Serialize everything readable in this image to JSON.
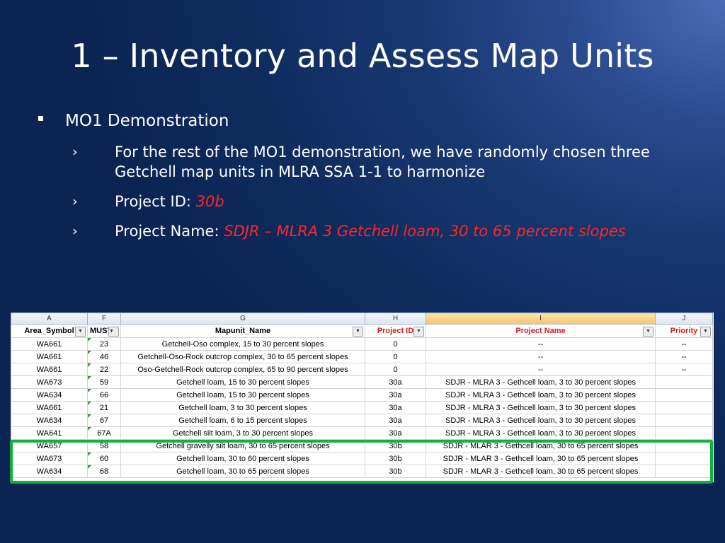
{
  "slide": {
    "title": "1 – Inventory and Assess Map Units",
    "bullet1": "MO1 Demonstration",
    "sub1": "For the rest of the MO1 demonstration, we have randomly chosen three Getchell map units in MLRA SSA 1-1 to harmonize",
    "sub2_label": "Project ID: ",
    "sub2_value": "30b",
    "sub3_label": "Project Name: ",
    "sub3_value": "SDJR – MLRA 3 Getchell loam, 30 to 65 percent slopes",
    "arrow_glyph": "›"
  },
  "sheet": {
    "column_letters": [
      "A",
      "F",
      "G",
      "H",
      "I",
      "J"
    ],
    "headers": [
      "Area_Symbol",
      "MUSY",
      "Mapunit_Name",
      "Project ID",
      "Project Name",
      "Priority"
    ],
    "rows": [
      [
        "WA661",
        "23",
        "Getchell-Oso complex, 15 to 30 percent slopes",
        "0",
        "--",
        "--"
      ],
      [
        "WA661",
        "46",
        "Getchell-Oso-Rock outcrop complex, 30 to 65 percent slopes",
        "0",
        "--",
        "--"
      ],
      [
        "WA661",
        "22",
        "Oso-Getchell-Rock outcrop complex, 65 to 90 percent slopes",
        "0",
        "--",
        "--"
      ],
      [
        "WA673",
        "59",
        "Getchell loam, 15 to 30 percent slopes",
        "30a",
        "SDJR - MLRA 3 - Gethcell loam, 3 to 30 percent slopes",
        ""
      ],
      [
        "WA634",
        "66",
        "Getchell loam, 15 to 30 percent slopes",
        "30a",
        "SDJR - MLRA 3 - Gethcell loam, 3 to 30 percent slopes",
        ""
      ],
      [
        "WA661",
        "21",
        "Getchell loam, 3 to 30 percent slopes",
        "30a",
        "SDJR - MLRA 3 - Gethcell loam, 3 to 30 percent slopes",
        ""
      ],
      [
        "WA634",
        "67",
        "Getchell loam, 6 to 15 percent slopes",
        "30a",
        "SDJR - MLRA 3 - Gethcell loam, 3 to 30 percent slopes",
        ""
      ],
      [
        "WA641",
        "67A",
        "Getchell silt loam, 3 to 30 percent slopes",
        "30a",
        "SDJR - MLRA 3 - Gethcell loam, 3 to 30 percent slopes",
        ""
      ],
      [
        "WA657",
        "58",
        "Getchell gravelly silt loam, 30 to 65 percent slopes",
        "30b",
        "SDJR - MLAR 3 - Gethcell loam, 30 to 65 percent slopes",
        ""
      ],
      [
        "WA673",
        "60",
        "Getchell loam, 30 to 60 percent slopes",
        "30b",
        "SDJR - MLAR 3 - Gethcell loam, 30 to 65 percent slopes",
        ""
      ],
      [
        "WA634",
        "68",
        "Getchell loam, 30 to 65 percent slopes",
        "30b",
        "SDJR - MLAR 3 - Gethcell loam, 30 to 65 percent slopes",
        ""
      ]
    ]
  },
  "colors": {
    "accent_red": "#ff2626",
    "highlight_green": "#13b03c"
  }
}
